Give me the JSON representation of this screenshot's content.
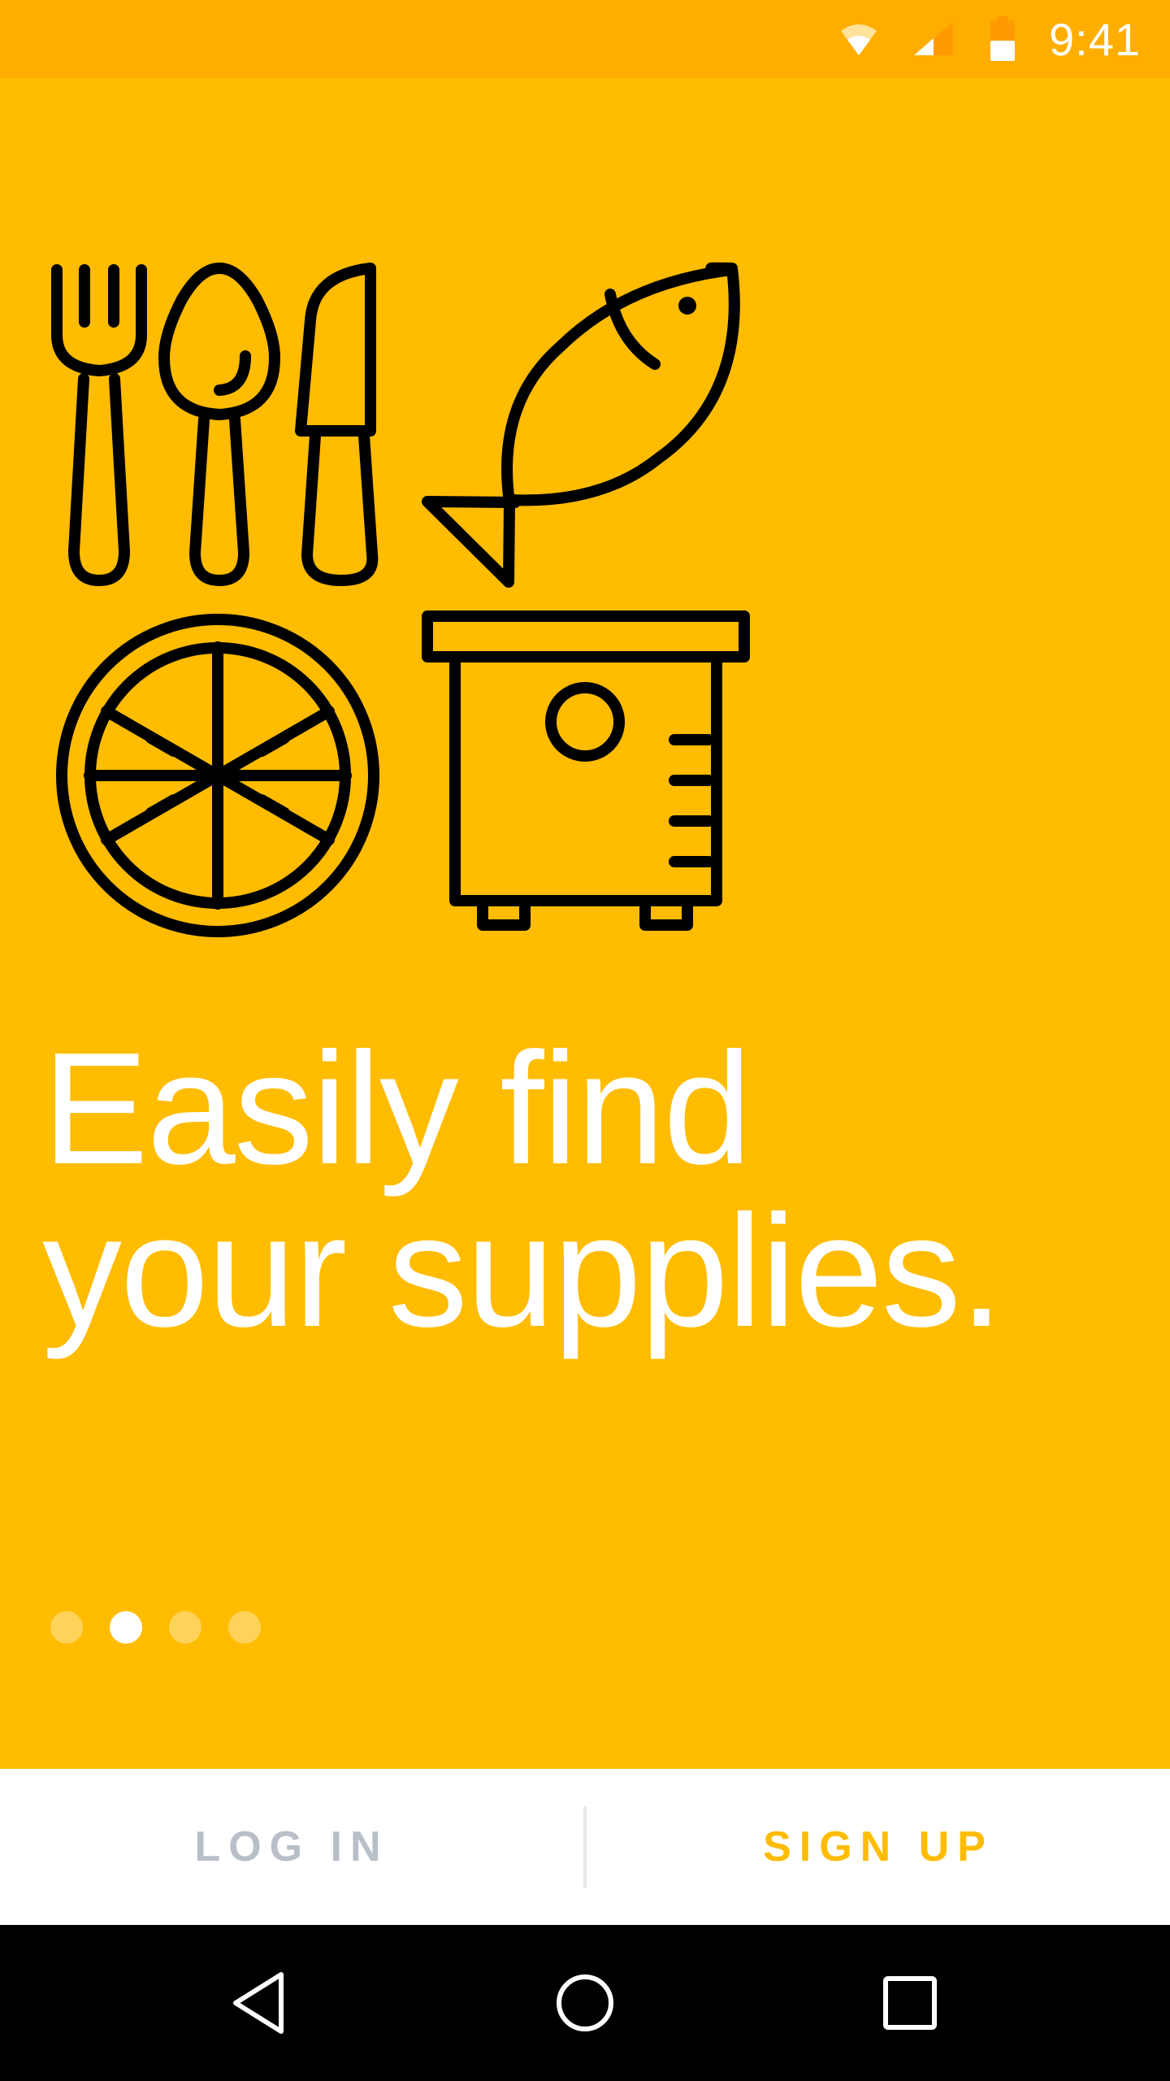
{
  "status_bar": {
    "time": "9:41",
    "icons": [
      "wifi-icon",
      "signal-icon",
      "battery-icon"
    ]
  },
  "onboarding": {
    "illustration_icons": [
      "fork-icon",
      "spoon-icon",
      "knife-icon",
      "fish-icon",
      "lemon-icon",
      "appliance-icon"
    ],
    "headline_line1": "Easily find",
    "headline_line2": "your supplies.",
    "pager": {
      "current_page": 2,
      "total_pages": 4
    }
  },
  "actions": {
    "login_label": "LOG IN",
    "signup_label": "SIGN UP"
  },
  "nav_bar": {
    "icons": [
      "back-icon",
      "home-icon",
      "recents-icon"
    ]
  },
  "colors": {
    "primary": "#FFBC00",
    "status_bar": "#FFAE00",
    "login_text": "#B8BFC8",
    "signup_text": "#FFBC00"
  }
}
